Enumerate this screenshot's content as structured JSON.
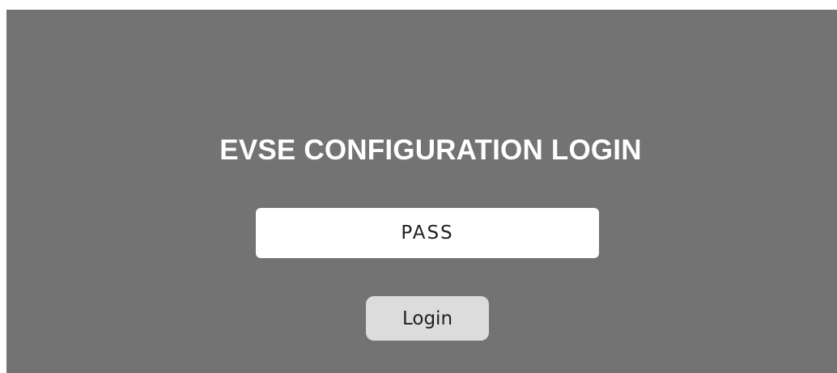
{
  "login": {
    "title": "EVSE CONFIGURATION LOGIN",
    "password_placeholder": "PASS",
    "password_value": "",
    "button_label": "Login"
  },
  "colors": {
    "panel_background": "#737373",
    "title_text": "#ffffff",
    "input_background": "#ffffff",
    "button_background": "#dcdcdc",
    "control_text": "#1f1f1f"
  }
}
